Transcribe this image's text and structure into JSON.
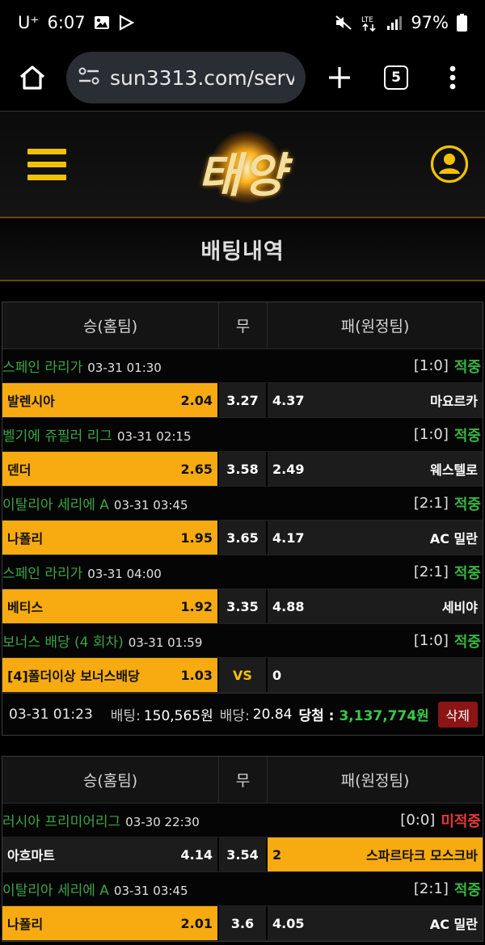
{
  "status_bar": {
    "carrier": "U⁺",
    "time": "6:07",
    "battery": "97%",
    "icons": [
      "gallery-icon",
      "play-icon",
      "mute-icon",
      "lte-icon",
      "signal-icon",
      "battery-icon"
    ]
  },
  "browser": {
    "url": "sun3313.com/serv",
    "tab_count": "5",
    "icons": [
      "home-icon",
      "site-settings-icon",
      "add-tab-icon",
      "tabs-icon",
      "more-menu-icon"
    ]
  },
  "site": {
    "logo_text": "태양",
    "page_title": "배팅내역",
    "accent_color": "#f7ab10",
    "win_color": "#37b541",
    "lose_color": "#e53935"
  },
  "columns": {
    "home": "승(홈팀)",
    "draw": "무",
    "away": "패(원정팀)"
  },
  "bets": [
    {
      "matches": [
        {
          "league": "스페인 라리가",
          "time": "03-31 01:30",
          "score": "[1:0]",
          "result": "적중",
          "home": "발렌시아",
          "home_odds": "2.04",
          "draw_odds": "3.27",
          "away_odds": "4.37",
          "away": "마요르카",
          "pick": "home"
        },
        {
          "league": "벨기에 쥬필러 리그",
          "time": "03-31 02:15",
          "score": "[1:0]",
          "result": "적중",
          "home": "덴더",
          "home_odds": "2.65",
          "draw_odds": "3.58",
          "away_odds": "2.49",
          "away": "웨스텔로",
          "pick": "home"
        },
        {
          "league": "이탈리아 세리에 A",
          "time": "03-31 03:45",
          "score": "[2:1]",
          "result": "적중",
          "home": "나폴리",
          "home_odds": "1.95",
          "draw_odds": "3.65",
          "away_odds": "4.17",
          "away": "AC 밀란",
          "pick": "home"
        },
        {
          "league": "스페인 라리가",
          "time": "03-31 04:00",
          "score": "[2:1]",
          "result": "적중",
          "home": "베티스",
          "home_odds": "1.92",
          "draw_odds": "3.35",
          "away_odds": "4.88",
          "away": "세비야",
          "pick": "home"
        },
        {
          "league": "보너스 배당 (4 회차)",
          "time": "03-31 01:59",
          "score": "[1:0]",
          "result": "적중",
          "home": "[4]폴더이상 보너스배당",
          "home_odds": "1.03",
          "draw_odds": "VS",
          "away_odds": "0",
          "away": "",
          "pick": "home"
        }
      ],
      "summary": {
        "date": "03-31 01:23",
        "bet_label": "배팅:",
        "bet_amount": "150,565원",
        "odds_label": "배당:",
        "odds": "20.84",
        "win_label": "당첨 :",
        "win_amount": "3,137,774원",
        "delete_label": "삭제"
      }
    },
    {
      "matches": [
        {
          "league": "러시아 프리미어리그",
          "time": "03-30 22:30",
          "score": "[0:0]",
          "result": "미적중",
          "home": "아흐마트",
          "home_odds": "4.14",
          "draw_odds": "3.54",
          "away_odds": "2",
          "away": "스파르타크 모스크바",
          "pick": "away"
        },
        {
          "league": "이탈리아 세리에 A",
          "time": "03-31 03:45",
          "score": "[2:1]",
          "result": "적중",
          "home": "나폴리",
          "home_odds": "2.01",
          "draw_odds": "3.6",
          "away_odds": "4.05",
          "away": "AC 밀란",
          "pick": "home"
        }
      ]
    }
  ]
}
